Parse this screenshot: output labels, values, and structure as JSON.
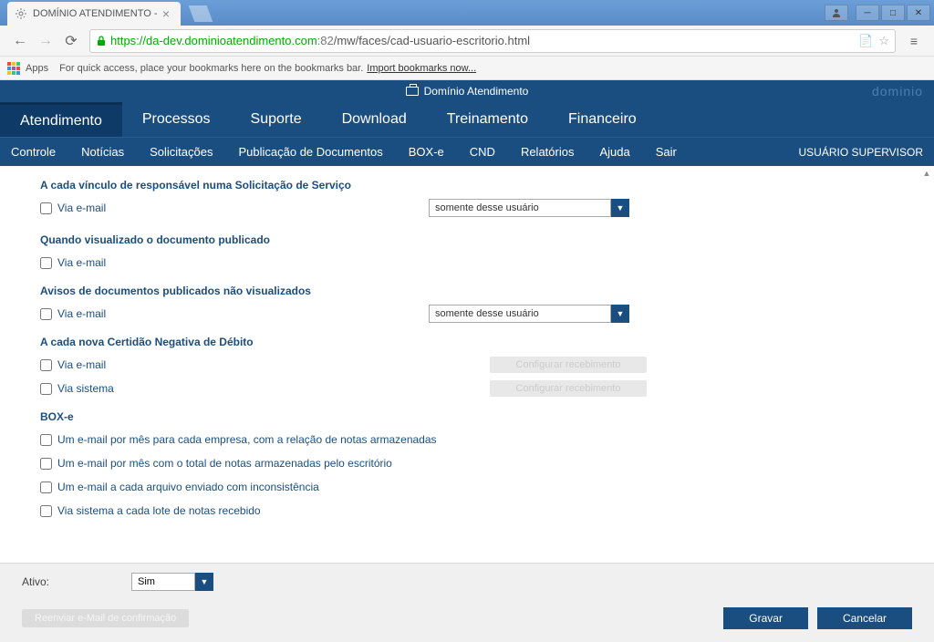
{
  "browser": {
    "tab_title": "DOMÍNIO ATENDIMENTO -",
    "url_proto": "https",
    "url_host": "://da-dev.dominioatendimento.com",
    "url_port": ":82",
    "url_path": "/mw/faces/cad-usuario-escritorio.html",
    "apps_label": "Apps",
    "bookmarks_hint": "For quick access, place your bookmarks here on the bookmarks bar.",
    "import_link": "Import bookmarks now..."
  },
  "app": {
    "header_title": "Domínio Atendimento",
    "brand": "dominio"
  },
  "main_nav": [
    "Atendimento",
    "Processos",
    "Suporte",
    "Download",
    "Treinamento",
    "Financeiro"
  ],
  "sub_nav": [
    "Controle",
    "Notícias",
    "Solicitações",
    "Publicação de Documentos",
    "BOX-e",
    "CND",
    "Relatórios",
    "Ajuda",
    "Sair"
  ],
  "user_label": "USUÁRIO SUPERVISOR",
  "sections": {
    "s1_title": "A cada vínculo de responsável numa Solicitação de Serviço",
    "s1_c1": "Via e-mail",
    "s1_dd": "somente desse usuário",
    "s2_title": "Quando visualizado o documento publicado",
    "s2_c1": "Via e-mail",
    "s3_title": "Avisos de documentos publicados não visualizados",
    "s3_c1": "Via e-mail",
    "s3_dd": "somente desse usuário",
    "s4_title": "A cada nova Certidão Negativa de Débito",
    "s4_c1": "Via e-mail",
    "s4_c2": "Via sistema",
    "s4_btn": "Configurar recebimento",
    "s5_title": "BOX-e",
    "s5_c1": "Um e-mail por mês para cada empresa, com a relação de notas armazenadas",
    "s5_c2": "Um e-mail por mês com o total de notas armazenadas pelo escritório",
    "s5_c3": "Um e-mail a cada arquivo enviado com inconsistência",
    "s5_c4": "Via sistema a cada lote de notas recebido"
  },
  "footer": {
    "ativo_label": "Ativo:",
    "ativo_value": "Sim",
    "resend_label": "Reenviar e-Mail de confirmação",
    "save": "Gravar",
    "cancel": "Cancelar"
  }
}
